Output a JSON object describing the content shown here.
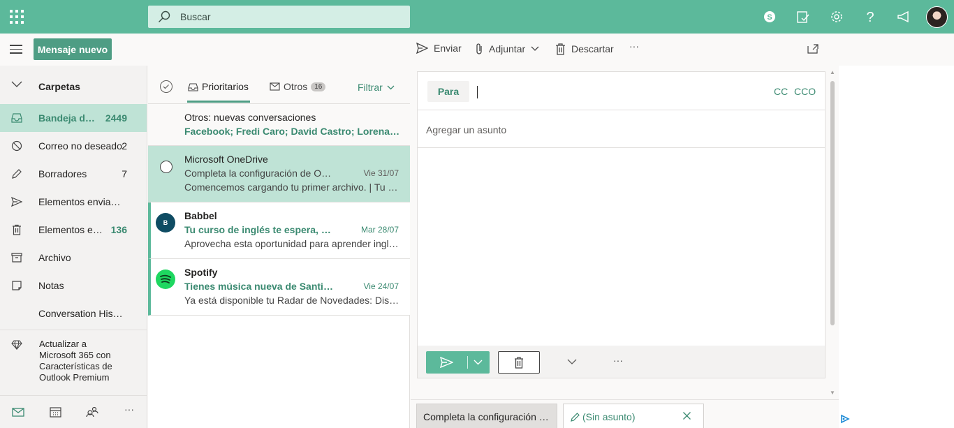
{
  "topbar": {
    "search_placeholder": "Buscar",
    "icons": [
      "app-launcher-icon",
      "search-icon",
      "skype-icon",
      "todo-icon",
      "gear-icon",
      "help-icon",
      "megaphone-icon",
      "avatar"
    ]
  },
  "commands": {
    "new_message": "Mensaje nuevo",
    "send": "Enviar",
    "attach": "Adjuntar",
    "discard": "Descartar",
    "more": "···"
  },
  "folders": {
    "header": "Carpetas",
    "items": [
      {
        "label": "Bandeja de entrada",
        "count": "2449",
        "icon": "inbox-icon"
      },
      {
        "label": "Correo no deseado",
        "count": "2",
        "icon": "junk-icon"
      },
      {
        "label": "Borradores",
        "count": "7",
        "icon": "pencil-icon"
      },
      {
        "label": "Elementos enviados",
        "count": "",
        "icon": "send-icon"
      },
      {
        "label": "Elementos eliminados",
        "count": "136",
        "icon": "trash-icon"
      },
      {
        "label": "Archivo",
        "count": "",
        "icon": "archive-icon"
      },
      {
        "label": "Notas",
        "count": "",
        "icon": "note-icon"
      },
      {
        "label": "Conversation History",
        "count": "",
        "icon": ""
      }
    ],
    "upgrade": "Actualizar a Microsoft 365 con Características de Outlook Premium",
    "more": "···"
  },
  "list": {
    "tab_focused": "Prioritarios",
    "tab_other": "Otros",
    "tab_other_count": "16",
    "filter": "Filtrar",
    "banner_title": "Otros: nuevas conversaciones",
    "banner_senders": "Facebook; Fredi Caro; David Castro; Lorena Cardona",
    "messages": [
      {
        "from": "Microsoft OneDrive",
        "subject": "Completa la configuración de OneDrive",
        "date": "Vie 31/07",
        "preview": "Comencemos cargando tu primer archivo. | Tu OneDrive",
        "avatar": ""
      },
      {
        "from": "Babbel",
        "subject": "Tu curso de inglés te espera, ahora con descuento",
        "date": "Mar 28/07",
        "preview": "Aprovecha esta oportunidad para aprender inglés hoy",
        "avatar": "B"
      },
      {
        "from": "Spotify",
        "subject": "Tienes música nueva de Santiago Cruz",
        "date": "Vie 24/07",
        "preview": "Ya está disponible tu Radar de Novedades: Disfruta de",
        "avatar": ""
      }
    ]
  },
  "compose": {
    "to_label": "Para",
    "cc": "CC",
    "bcc": "CCO",
    "subject_placeholder": "Agregar un asunto",
    "more": "···"
  },
  "bottom_tabs": {
    "tab1": "Completa la configuración de OneDrive",
    "tab2": "(Sin asunto)"
  },
  "colors": {
    "brand": "#5cb99b",
    "brand_dark": "#3b8a71",
    "selected": "#bfe3d6"
  }
}
